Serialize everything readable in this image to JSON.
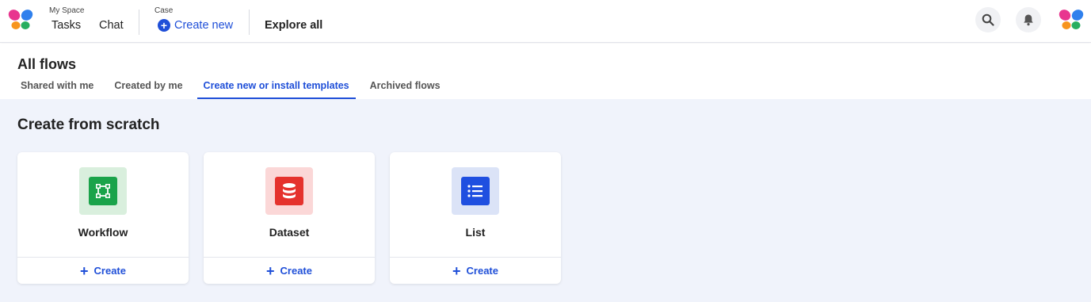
{
  "topnav": {
    "my_space_label": "My Space",
    "tasks": "Tasks",
    "chat": "Chat",
    "case_label": "Case",
    "create_new": "Create new",
    "explore_all": "Explore all",
    "icons": [
      "butterfly-logo-icon",
      "search-icon",
      "bell-icon",
      "butterfly-logo-icon"
    ]
  },
  "page": {
    "title": "All flows",
    "tabs": [
      {
        "label": "Shared with me",
        "active": false
      },
      {
        "label": "Created by me",
        "active": false
      },
      {
        "label": "Create new or install templates",
        "active": true
      },
      {
        "label": "Archived flows",
        "active": false
      }
    ]
  },
  "section": {
    "title": "Create from scratch",
    "cards": [
      {
        "title": "Workflow",
        "action": "Create",
        "icon": "workflow-icon",
        "icon_bg": "#d9efdd",
        "icon_color": "#1aa34a"
      },
      {
        "title": "Dataset",
        "action": "Create",
        "icon": "database-icon",
        "icon_bg": "#fbd7d7",
        "icon_color": "#e5322d"
      },
      {
        "title": "List",
        "action": "Create",
        "icon": "list-icon",
        "icon_bg": "#dbe3f7",
        "icon_color": "#1f4fe0"
      }
    ]
  },
  "colors": {
    "accent": "#1f4fd8",
    "content_bg": "#f0f3fb"
  }
}
